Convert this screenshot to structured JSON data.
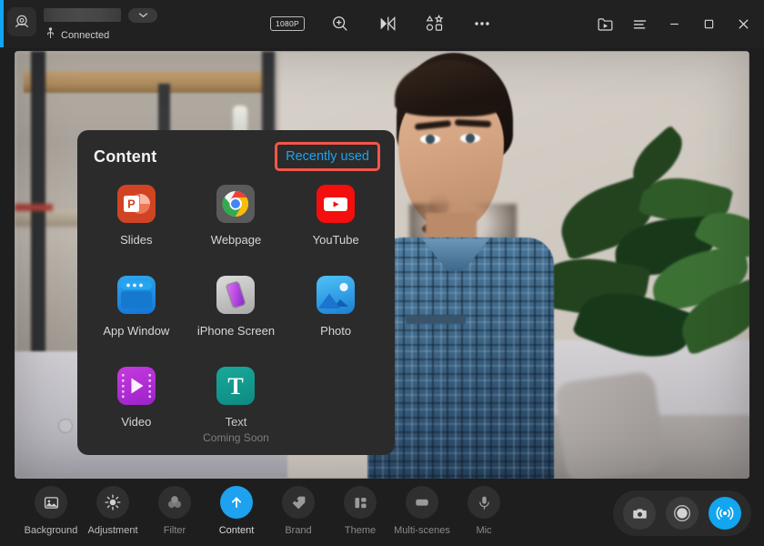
{
  "titlebar": {
    "camera_icon": "webcam-icon",
    "device_name": "",
    "device_dropdown_icon": "chevron-down-icon",
    "usb_icon": "usb-icon",
    "connection_status": "Connected",
    "resolution_badge": "1080P",
    "zoom_icon": "zoom-in-icon",
    "mirror_icon": "mirror-flip-icon",
    "effects_icon": "shapes-sticker-icon",
    "more_icon": "more-horizontal-icon",
    "media_icon": "media-library-icon",
    "menu_icon": "hamburger-menu-icon",
    "minimize_icon": "minimize-icon",
    "maximize_icon": "maximize-icon",
    "close_icon": "close-icon"
  },
  "panel": {
    "title": "Content",
    "recently_used_label": "Recently used",
    "highlight_color": "#f4564a",
    "link_color": "#1ea1ee",
    "items": [
      {
        "label": "Slides",
        "icon": "powerpoint-icon",
        "sub": ""
      },
      {
        "label": "Webpage",
        "icon": "chrome-icon",
        "sub": ""
      },
      {
        "label": "YouTube",
        "icon": "youtube-icon",
        "sub": ""
      },
      {
        "label": "App Window",
        "icon": "app-window-icon",
        "sub": ""
      },
      {
        "label": "iPhone Screen",
        "icon": "iphone-screen-icon",
        "sub": ""
      },
      {
        "label": "Photo",
        "icon": "photo-icon",
        "sub": ""
      },
      {
        "label": "Video",
        "icon": "video-icon",
        "sub": ""
      },
      {
        "label": "Text",
        "icon": "text-icon",
        "sub": "Coming Soon"
      }
    ]
  },
  "toolbar": {
    "items": [
      {
        "label": "Background",
        "icon": "image-icon",
        "state": "normal"
      },
      {
        "label": "Adjustment",
        "icon": "brightness-icon",
        "state": "normal"
      },
      {
        "label": "Filter",
        "icon": "filter-circles-icon",
        "state": "dim"
      },
      {
        "label": "Content",
        "icon": "upload-arrow-icon",
        "state": "active"
      },
      {
        "label": "Brand",
        "icon": "tag-icon",
        "state": "dim"
      },
      {
        "label": "Theme",
        "icon": "layout-blocks-icon",
        "state": "dim"
      },
      {
        "label": "Multi-scenes",
        "icon": "scenes-icon",
        "state": "dim"
      },
      {
        "label": "Mic",
        "icon": "microphone-icon",
        "state": "dim"
      }
    ],
    "actions": [
      {
        "icon": "camera-snapshot-icon",
        "state": "normal"
      },
      {
        "icon": "record-icon",
        "state": "normal"
      },
      {
        "icon": "live-broadcast-icon",
        "state": "active"
      }
    ],
    "accent_color": "#12a5f0"
  }
}
